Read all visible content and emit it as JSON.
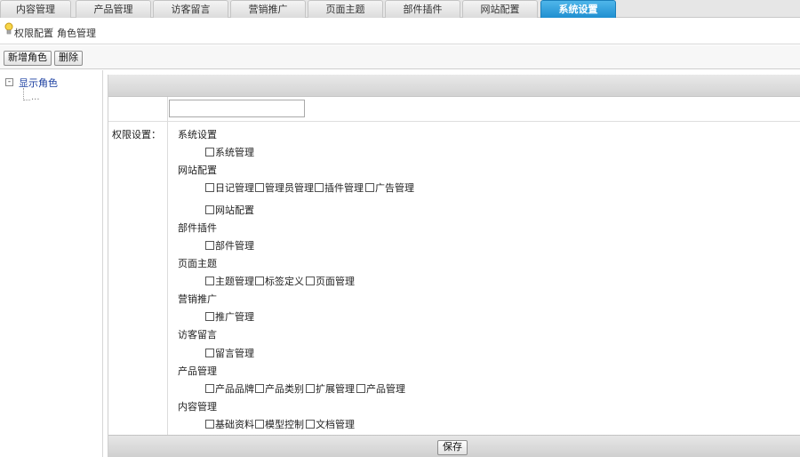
{
  "tabs": [
    {
      "label": "内容管理",
      "active": false
    },
    {
      "label": "产品管理",
      "active": false
    },
    {
      "label": "访客留言",
      "active": false
    },
    {
      "label": "营销推广",
      "active": false
    },
    {
      "label": "页面主题",
      "active": false
    },
    {
      "label": "部件插件",
      "active": false
    },
    {
      "label": "网站配置",
      "active": false
    },
    {
      "label": "系统设置",
      "active": true
    }
  ],
  "breadcrumb": {
    "first": "权限配置",
    "separator": "/",
    "second": "角色管理"
  },
  "toolbar": {
    "add_label": "新增角色",
    "delete_label": "删除"
  },
  "tree": {
    "toggle": "-",
    "root_label": "显示角色",
    "child_label": "..."
  },
  "form": {
    "name_value": "",
    "permission_label": "权限设置：",
    "groups": [
      {
        "title": "系统设置",
        "items": [
          "系统管理"
        ]
      },
      {
        "title": "网站配置",
        "items": [
          "日记管理",
          "管理员管理",
          "插件管理",
          "广告管理",
          "网站配置"
        ]
      },
      {
        "title": "部件插件",
        "items": [
          "部件管理"
        ]
      },
      {
        "title": "页面主题",
        "items": [
          "主题管理",
          "标签定义",
          "页面管理"
        ]
      },
      {
        "title": "营销推广",
        "items": [
          "推广管理"
        ]
      },
      {
        "title": "访客留言",
        "items": [
          "留言管理"
        ]
      },
      {
        "title": "产品管理",
        "items": [
          "产品品牌",
          "产品类别",
          "扩展管理",
          "产品管理"
        ]
      },
      {
        "title": "内容管理",
        "items": [
          "基础资料",
          "模型控制",
          "文档管理"
        ]
      }
    ],
    "save_label": "保存"
  },
  "colors": {
    "active_tab": "#2a9ad8",
    "tree_link": "#1a3ea0"
  }
}
